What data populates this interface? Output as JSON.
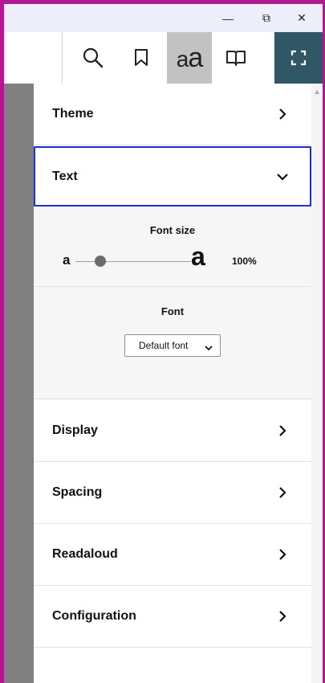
{
  "window": {
    "minimize_glyph": "—",
    "maximize_glyph": "⧉",
    "close_glyph": "✕"
  },
  "toolbar": {
    "buttons": [
      {
        "name": "search",
        "icon": "search-icon"
      },
      {
        "name": "bookmark",
        "icon": "bookmark-icon"
      },
      {
        "name": "text-settings",
        "icon": "text-size-icon",
        "text_small": "a",
        "text_big": "a",
        "active": true
      },
      {
        "name": "contents",
        "icon": "book-icon"
      },
      {
        "name": "fullscreen",
        "icon": "fullscreen-icon"
      }
    ],
    "active_bg": "#c2c2c2",
    "fullscreen_bg": "#2f5766"
  },
  "panel": {
    "sections": [
      {
        "label": "Theme",
        "expanded": false
      },
      {
        "label": "Text",
        "expanded": true
      },
      {
        "label": "Display",
        "expanded": false
      },
      {
        "label": "Spacing",
        "expanded": false
      },
      {
        "label": "Readaloud",
        "expanded": false
      },
      {
        "label": "Configuration",
        "expanded": false
      }
    ],
    "text_settings": {
      "font_size_label": "Font size",
      "slider_small": "a",
      "slider_big": "a",
      "font_size_value": "100%",
      "font_size_fraction": 0.17,
      "font_label": "Font",
      "font_selected": "Default font"
    }
  },
  "colors": {
    "window_border": "#b0198f",
    "focus_outline": "#1c2fd0",
    "side_strip": "#808080"
  }
}
